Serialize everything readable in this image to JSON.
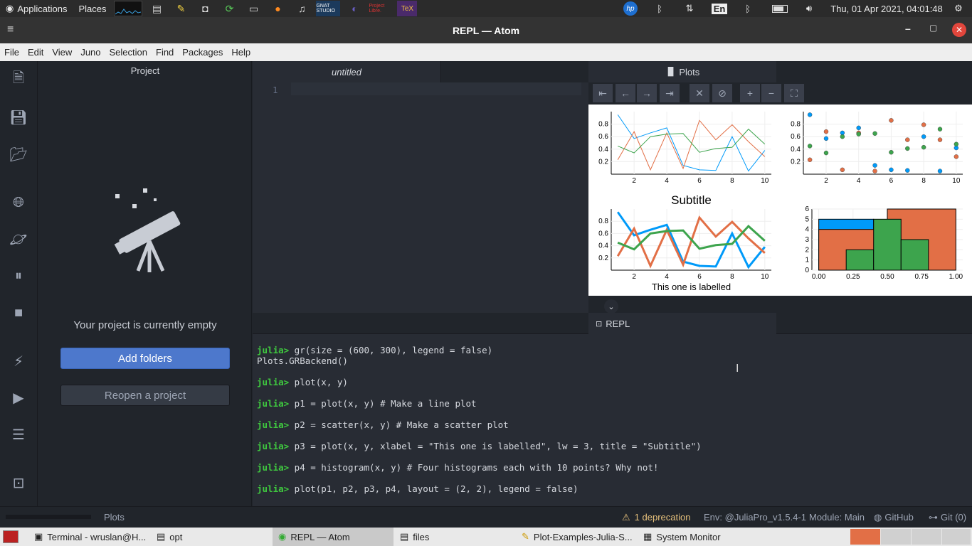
{
  "top_panel": {
    "applications": "Applications",
    "places": "Places",
    "keyboard_layout": "En",
    "datetime": "Thu, 01 Apr 2021, 04:01:48",
    "launchers": [
      "system-monitor-icon",
      "files-icon",
      "text-editor-icon",
      "screenshot-icon",
      "refresh-icon",
      "terminal-icon",
      "firefox-icon",
      "music-icon",
      "gnat-studio-icon",
      "eclipse-icon",
      "project-libre-icon",
      "tex-icon"
    ],
    "launcher_labels": {
      "gnat": "GNAT STUDIO",
      "project_libre": "Project Libre.",
      "tex": "TeX"
    }
  },
  "window": {
    "title": "REPL — Atom"
  },
  "menu": [
    "File",
    "Edit",
    "View",
    "Juno",
    "Selection",
    "Find",
    "Packages",
    "Help"
  ],
  "project": {
    "title": "Project",
    "empty_message": "Your project is currently empty",
    "add_folders": "Add folders",
    "reopen": "Reopen a project"
  },
  "editor": {
    "tab_title": "untitled",
    "line_number": "1"
  },
  "plots_pane": {
    "tab_title": "Plots"
  },
  "chart_data": [
    {
      "type": "line",
      "x": [
        1,
        2,
        3,
        4,
        5,
        6,
        7,
        8,
        9,
        10
      ],
      "xlim": [
        0.6,
        10.4
      ],
      "ylim": [
        0,
        1
      ],
      "xticks": [
        "2",
        "4",
        "6",
        "8",
        "10"
      ],
      "yticks": [
        "0.2",
        "0.4",
        "0.6",
        "0.8"
      ],
      "series": [
        {
          "color": "#009af9",
          "values": [
            0.95,
            0.57,
            0.66,
            0.74,
            0.14,
            0.07,
            0.06,
            0.6,
            0.05,
            0.38
          ]
        },
        {
          "color": "#e26f46",
          "values": [
            0.23,
            0.68,
            0.07,
            0.66,
            0.09,
            0.86,
            0.55,
            0.79,
            0.52,
            0.28
          ]
        },
        {
          "color": "#3da44d",
          "values": [
            0.45,
            0.34,
            0.6,
            0.64,
            0.65,
            0.35,
            0.41,
            0.43,
            0.72,
            0.48
          ]
        }
      ]
    },
    {
      "type": "scatter",
      "x": [
        1,
        2,
        3,
        4,
        5,
        6,
        7,
        8,
        9,
        10
      ],
      "xlim": [
        0.6,
        10.4
      ],
      "ylim": [
        0,
        1
      ],
      "xticks": [
        "2",
        "4",
        "6",
        "8",
        "10"
      ],
      "yticks": [
        "0.2",
        "0.4",
        "0.6",
        "0.8"
      ],
      "series": [
        {
          "color": "#009af9",
          "values": [
            0.95,
            0.57,
            0.66,
            0.74,
            0.14,
            0.07,
            0.06,
            0.6,
            0.05,
            0.42
          ]
        },
        {
          "color": "#e26f46",
          "values": [
            0.23,
            0.68,
            0.07,
            0.66,
            0.05,
            0.86,
            0.55,
            0.79,
            0.55,
            0.28
          ]
        },
        {
          "color": "#3da44d",
          "values": [
            0.45,
            0.34,
            0.6,
            0.64,
            0.65,
            0.35,
            0.41,
            0.43,
            0.72,
            0.48
          ]
        }
      ]
    },
    {
      "type": "line",
      "title": "Subtitle",
      "xlabel": "This one is labelled",
      "x": [
        1,
        2,
        3,
        4,
        5,
        6,
        7,
        8,
        9,
        10
      ],
      "xlim": [
        0.6,
        10.4
      ],
      "ylim": [
        0,
        1
      ],
      "xticks": [
        "2",
        "4",
        "6",
        "8",
        "10"
      ],
      "yticks": [
        "0.2",
        "0.4",
        "0.6",
        "0.8"
      ],
      "series": [
        {
          "color": "#009af9",
          "values": [
            0.95,
            0.57,
            0.66,
            0.74,
            0.14,
            0.07,
            0.06,
            0.6,
            0.05,
            0.38
          ]
        },
        {
          "color": "#e26f46",
          "values": [
            0.23,
            0.68,
            0.07,
            0.66,
            0.09,
            0.86,
            0.55,
            0.79,
            0.52,
            0.28
          ]
        },
        {
          "color": "#3da44d",
          "values": [
            0.45,
            0.34,
            0.6,
            0.64,
            0.65,
            0.35,
            0.41,
            0.43,
            0.72,
            0.48
          ]
        }
      ]
    },
    {
      "type": "bar",
      "xlim": [
        -0.05,
        1.05
      ],
      "ylim": [
        0,
        6
      ],
      "xticks": [
        "0.00",
        "0.25",
        "0.50",
        "0.75",
        "1.00"
      ],
      "yticks": [
        "0",
        "1",
        "2",
        "3",
        "4",
        "5",
        "6"
      ],
      "bins": [
        {
          "x0": 0.0,
          "x1": 0.4,
          "value": 5,
          "color": "#009af9"
        },
        {
          "x0": 0.0,
          "x1": 0.5,
          "value": 4,
          "color": "#e26f46"
        },
        {
          "x0": 0.5,
          "x1": 1.0,
          "value": 6,
          "color": "#e26f46"
        },
        {
          "x0": 0.2,
          "x1": 0.4,
          "value": 2,
          "color": "#3da44d"
        },
        {
          "x0": 0.4,
          "x1": 0.6,
          "value": 5,
          "color": "#3da44d"
        },
        {
          "x0": 0.6,
          "x1": 0.8,
          "value": 3,
          "color": "#3da44d"
        }
      ]
    }
  ],
  "repl": {
    "tab_title": "REPL",
    "prompt": "julia>",
    "lines": [
      {
        "cmd": " gr(size = (600, 300), legend = false)",
        "out": "Plots.GRBackend()"
      },
      {
        "cmd": " plot(x, y)",
        "out": ""
      },
      {
        "cmd": " p1 = plot(x, y) # Make a line plot",
        "out": ""
      },
      {
        "cmd": " p2 = scatter(x, y) # Make a scatter plot",
        "out": ""
      },
      {
        "cmd": " p3 = plot(x, y, xlabel = \"This one is labelled\", lw = 3, title = \"Subtitle\")",
        "out": ""
      },
      {
        "cmd": " p4 = histogram(x, y) # Four histograms each with 10 points? Why not!",
        "out": ""
      },
      {
        "cmd": " plot(p1, p2, p3, p4, layout = (2, 2), legend = false)",
        "out": ""
      }
    ]
  },
  "status": {
    "left": "Plots",
    "deprecation": "1 deprecation",
    "env": "Env: @JuliaPro_v1.5.4-1",
    "module": "Module: Main",
    "github": "GitHub",
    "git": "Git (0)"
  },
  "taskbar": [
    {
      "label": "Terminal - wruslan@H...",
      "active": false
    },
    {
      "label": "opt",
      "active": false
    },
    {
      "label": "REPL — Atom",
      "active": true
    },
    {
      "label": "files",
      "active": false
    },
    {
      "label": "Plot-Examples-Julia-S...",
      "active": false
    },
    {
      "label": "System Monitor",
      "active": false
    }
  ]
}
